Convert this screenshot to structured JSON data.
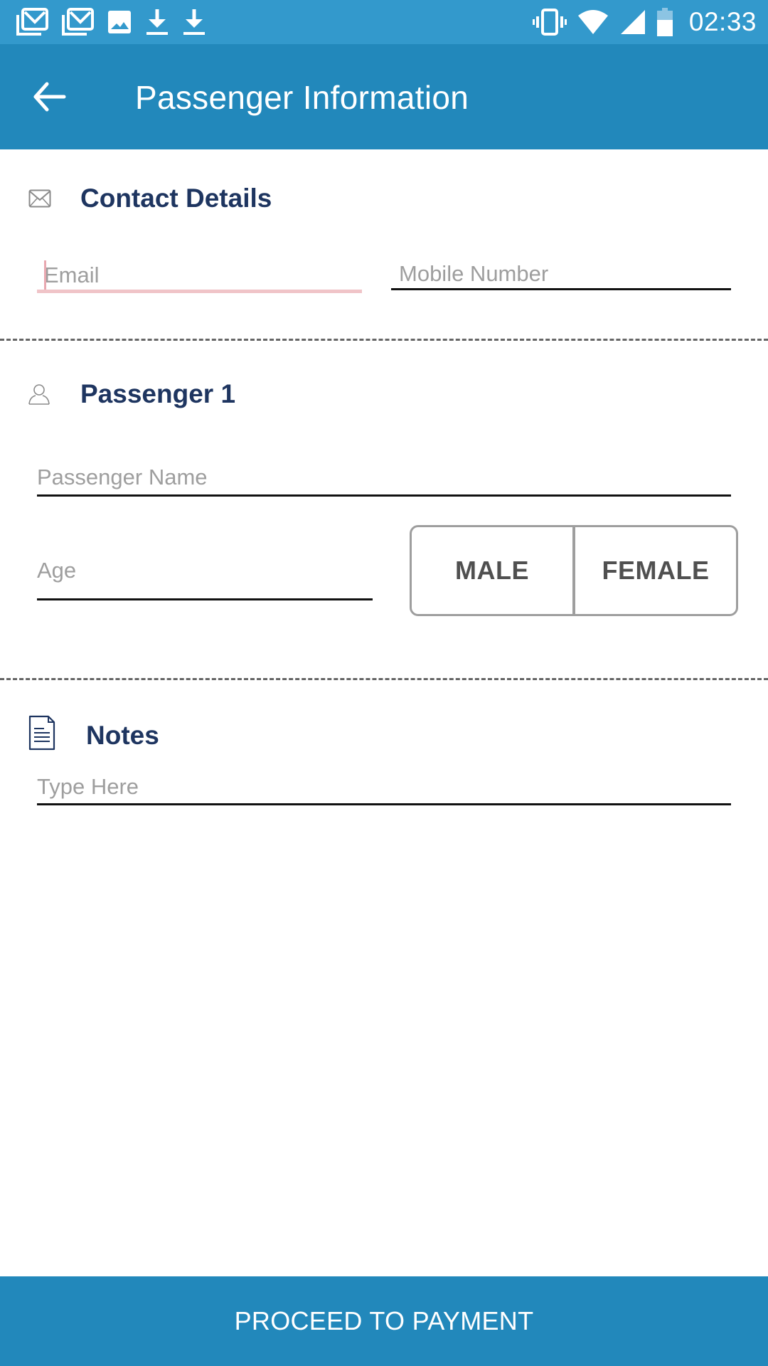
{
  "status_bar": {
    "left_icons": [
      "gmail-icon",
      "gmail-icon",
      "image-icon",
      "download-icon",
      "download-icon"
    ],
    "right_icons": [
      "vibrate-icon",
      "wifi-icon",
      "signal-icon",
      "battery-icon"
    ],
    "time": "02:33"
  },
  "app_bar": {
    "back_icon": "arrow-left-icon",
    "title": "Passenger Information"
  },
  "contact_section": {
    "icon": "envelope-icon",
    "title": "Contact Details",
    "email": {
      "value": "",
      "placeholder": "Email",
      "focused": true
    },
    "mobile": {
      "value": "",
      "placeholder": "Mobile Number"
    }
  },
  "passenger_section": {
    "icon": "person-icon",
    "title": "Passenger 1",
    "name": {
      "value": "",
      "placeholder": "Passenger Name"
    },
    "age": {
      "value": "",
      "placeholder": "Age"
    },
    "gender_options": [
      "MALE",
      "FEMALE"
    ]
  },
  "notes_section": {
    "icon": "document-icon",
    "title": "Notes",
    "notes": {
      "value": "",
      "placeholder": "Type Here"
    }
  },
  "footer": {
    "proceed_label": "PROCEED TO PAYMENT"
  },
  "colors": {
    "status_bar": "#3399cc",
    "primary": "#2288bb",
    "heading": "#1e3560",
    "placeholder": "#9e9e9e",
    "focus_underline": "#f0c4c8"
  }
}
